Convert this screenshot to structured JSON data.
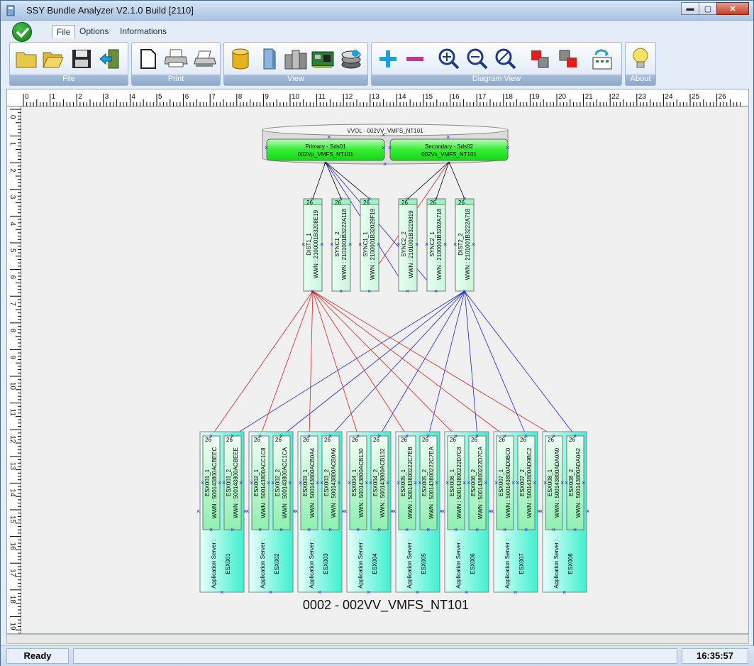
{
  "window": {
    "title": "SSY Bundle Analyzer  V2.1.0  Build [2110]"
  },
  "window_buttons": {
    "minimize": "▬",
    "maximize": "▢",
    "close": "✕"
  },
  "menu": {
    "tabs": [
      "File",
      "Options",
      "Informations"
    ],
    "active": "File"
  },
  "toolbar": {
    "groups": [
      {
        "label": "File",
        "icons": [
          "folder-icon",
          "open-folder-icon",
          "floppy-save-icon",
          "exit-door-icon"
        ]
      },
      {
        "label": "Print",
        "icons": [
          "new-page-icon",
          "printer-icon",
          "printer-setup-icon"
        ]
      },
      {
        "label": "View",
        "icons": [
          "database-icon",
          "server-icon",
          "server-rack-icon",
          "network-card-icon",
          "disk-stack-icon"
        ]
      },
      {
        "label": "Diagram View",
        "icons": [
          "expand-plus-icon",
          "collapse-minus-icon",
          "zoom-in-icon",
          "zoom-out-icon",
          "zoom-reset-icon",
          "layout-grey-icon",
          "layout-red-icon",
          "refresh-diagram-icon"
        ]
      },
      {
        "label": "About",
        "icons": [
          "lightbulb-icon"
        ]
      }
    ]
  },
  "rulers": {
    "horizontal": [
      "0",
      "1",
      "2",
      "3",
      "4",
      "5",
      "6",
      "7",
      "8",
      "9",
      "10",
      "11",
      "12",
      "13",
      "14",
      "15",
      "16",
      "17",
      "18",
      "19",
      "20",
      "21",
      "22",
      "23",
      "24",
      "25",
      "26"
    ],
    "vertical": [
      "0",
      "1",
      "2",
      "3",
      "4",
      "5",
      "6",
      "7",
      "8",
      "9",
      "10",
      "11",
      "12",
      "13",
      "14",
      "15",
      "16",
      "17",
      "18",
      "19"
    ]
  },
  "diagram": {
    "volume": {
      "title": "VVOL - 002VV_VMFS_NT101",
      "primary": {
        "line1": "Primary - Sds01",
        "line2": "002Vp_VMFS_NT101"
      },
      "secondary": {
        "line1": "Secondary - Sds02",
        "line2": "002Vs_VMFS_NT101"
      }
    },
    "ports": [
      {
        "count": "26",
        "name": "DIST1_1",
        "wwn": "WWN : 2100001B3208E19"
      },
      {
        "count": "26",
        "name": "SYNC1_2",
        "wwn": "WWN : 2101001B3222A118"
      },
      {
        "count": "26",
        "name": "SYNC1_1",
        "wwn": "WWN : 2100001B32029F19"
      },
      {
        "count": "26",
        "name": "SYNC2_2",
        "wwn": "WWN : 2101001B3229819"
      },
      {
        "count": "26",
        "name": "SYNC2_1",
        "wwn": "WWN : 2100001B3202A718"
      },
      {
        "count": "26",
        "name": "DIST2_2",
        "wwn": "WWN : 2101001B3222A718"
      }
    ],
    "servers": [
      {
        "label": "Application Server :",
        "name": "ESX001",
        "hbas": [
          {
            "count": "26",
            "name": "ESX001_1",
            "wwn": "WWN : 500143800ACBEEC"
          },
          {
            "count": "26",
            "name": "ESX001_2",
            "wwn": "WWN : 500143800ACBEEE"
          }
        ]
      },
      {
        "label": "Application Server :",
        "name": "ESX002",
        "hbas": [
          {
            "count": "26",
            "name": "ESX002_1",
            "wwn": "WWN : 500143800ACC1C8"
          },
          {
            "count": "26",
            "name": "ESX002_2",
            "wwn": "WWN : 500143800ACC1CA"
          }
        ]
      },
      {
        "label": "Application Server :",
        "name": "ESX003",
        "hbas": [
          {
            "count": "26",
            "name": "ESX003_1",
            "wwn": "WWN : 500143800ACB0A4"
          },
          {
            "count": "26",
            "name": "ESX003_2",
            "wwn": "WWN : 500143800ACB0A6"
          }
        ]
      },
      {
        "label": "Application Server :",
        "name": "ESX004",
        "hbas": [
          {
            "count": "26",
            "name": "ESX004_1",
            "wwn": "WWN : 500143800ACB130"
          },
          {
            "count": "26",
            "name": "ESX004_2",
            "wwn": "WWN : 500143800ACB132"
          }
        ]
      },
      {
        "label": "Application Server :",
        "name": "ESX005",
        "hbas": [
          {
            "count": "26",
            "name": "ESX005_1",
            "wwn": "WWN : 500143800222C7EB"
          },
          {
            "count": "26",
            "name": "ESX005_2",
            "wwn": "WWN : 500143800222C7EA"
          }
        ]
      },
      {
        "label": "Application Server :",
        "name": "ESX006",
        "hbas": [
          {
            "count": "26",
            "name": "ESX006_1",
            "wwn": "WWN : 500143800222D7C8"
          },
          {
            "count": "26",
            "name": "ESX006_2",
            "wwn": "WWN : 500143800222D7CA"
          }
        ]
      },
      {
        "label": "Application Server :",
        "name": "ESX007",
        "hbas": [
          {
            "count": "26",
            "name": "ESX007_1",
            "wwn": "WWN : 500143800AD9BC0"
          },
          {
            "count": "26",
            "name": "ESX007_2",
            "wwn": "WWN : 500143800AD9BC2"
          }
        ]
      },
      {
        "label": "Application Server :",
        "name": "ESX008",
        "hbas": [
          {
            "count": "26",
            "name": "ESX008_1",
            "wwn": "WWN : 500143800ADA0A0"
          },
          {
            "count": "26",
            "name": "ESX008_2",
            "wwn": "WWN : 500143800ADA0A2"
          }
        ]
      }
    ],
    "caption": "0002 - 002VV_VMFS_NT101",
    "colors": {
      "node_green": "#33ee33",
      "port_fill": "#c8f6dc",
      "server_fill": "#3ff0d0",
      "red_link": "#e02020",
      "blue_link": "#2020e0",
      "black_link": "#000000"
    }
  },
  "status": {
    "left": "Ready",
    "time": "16:35:57"
  }
}
